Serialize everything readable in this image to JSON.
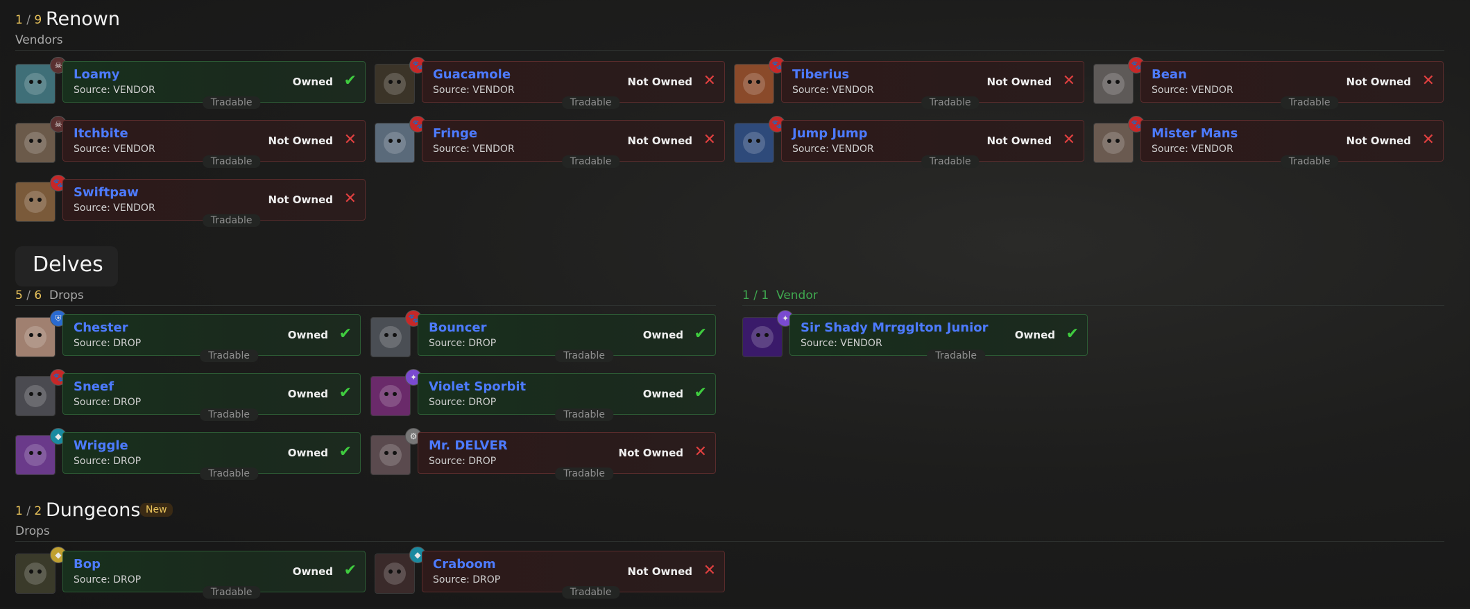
{
  "sections": {
    "renown": {
      "count_num": "1",
      "count_sep": "/",
      "count_den": "9",
      "title": "Renown",
      "subtitle": "Vendors"
    },
    "delves": {
      "title": "Delves",
      "drops": {
        "count_num": "5",
        "count_sep": "/",
        "count_den": "6",
        "label": "Drops"
      },
      "vendor": {
        "count_num": "1",
        "count_sep": "/",
        "count_den": "1",
        "label": "Vendor"
      }
    },
    "dungeons": {
      "count_num": "1",
      "count_sep": "/",
      "count_den": "2",
      "title": "Dungeons",
      "badge": "New",
      "subtitle": "Drops"
    }
  },
  "labels": {
    "tradable": "Tradable",
    "owned": "Owned",
    "not_owned": "Not Owned"
  },
  "pets": [
    {
      "name": "Loamy",
      "source": "Source: VENDOR",
      "owned": true,
      "icon": "loamy-icon",
      "badge": "skull"
    },
    {
      "name": "Guacamole",
      "source": "Source: VENDOR",
      "owned": false,
      "icon": "guacamole-icon",
      "badge": "paw"
    },
    {
      "name": "Tiberius",
      "source": "Source: VENDOR",
      "owned": false,
      "icon": "tiberius-icon",
      "badge": "paw"
    },
    {
      "name": "Bean",
      "source": "Source: VENDOR",
      "owned": false,
      "icon": "bean-icon",
      "badge": "paw"
    },
    {
      "name": "Itchbite",
      "source": "Source: VENDOR",
      "owned": false,
      "icon": "itchbite-icon",
      "badge": "skull"
    },
    {
      "name": "Fringe",
      "source": "Source: VENDOR",
      "owned": false,
      "icon": "fringe-icon",
      "badge": "paw"
    },
    {
      "name": "Jump Jump",
      "source": "Source: VENDOR",
      "owned": false,
      "icon": "jumpjump-icon",
      "badge": "paw"
    },
    {
      "name": "Mister Mans",
      "source": "Source: VENDOR",
      "owned": false,
      "icon": "mistermans-icon",
      "badge": "paw"
    },
    {
      "name": "Swiftpaw",
      "source": "Source: VENDOR",
      "owned": false,
      "icon": "swiftpaw-icon",
      "badge": "paw"
    },
    {
      "name": "Chester",
      "source": "Source: DROP",
      "owned": true,
      "icon": "chester-icon",
      "badge": "shield"
    },
    {
      "name": "Bouncer",
      "source": "Source: DROP",
      "owned": true,
      "icon": "bouncer-icon",
      "badge": "paw"
    },
    {
      "name": "Sneef",
      "source": "Source: DROP",
      "owned": true,
      "icon": "sneef-icon",
      "badge": "paw"
    },
    {
      "name": "Violet Sporbit",
      "source": "Source: DROP",
      "owned": true,
      "icon": "violet-sporbit-icon",
      "badge": "magic"
    },
    {
      "name": "Wriggle",
      "source": "Source: DROP",
      "owned": true,
      "icon": "wriggle-icon",
      "badge": "water"
    },
    {
      "name": "Mr. DELVER",
      "source": "Source: DROP",
      "owned": false,
      "icon": "mr-delver-icon",
      "badge": "gear"
    },
    {
      "name": "Sir Shady Mrrgglton Junior",
      "source": "Source: VENDOR",
      "owned": true,
      "icon": "sir-shady-icon",
      "badge": "magic"
    },
    {
      "name": "Bop",
      "source": "Source: DROP",
      "owned": true,
      "icon": "bop-icon",
      "badge": "flyer"
    },
    {
      "name": "Craboom",
      "source": "Source: DROP",
      "owned": false,
      "icon": "craboom-icon",
      "badge": "water"
    }
  ],
  "colors": {
    "owned_border": "#2c5a34",
    "not_owned_border": "#5a2c2c",
    "name": "#4d7bff",
    "count": "#e9c35b",
    "check": "#3fcc3f",
    "cross": "#e04040"
  }
}
